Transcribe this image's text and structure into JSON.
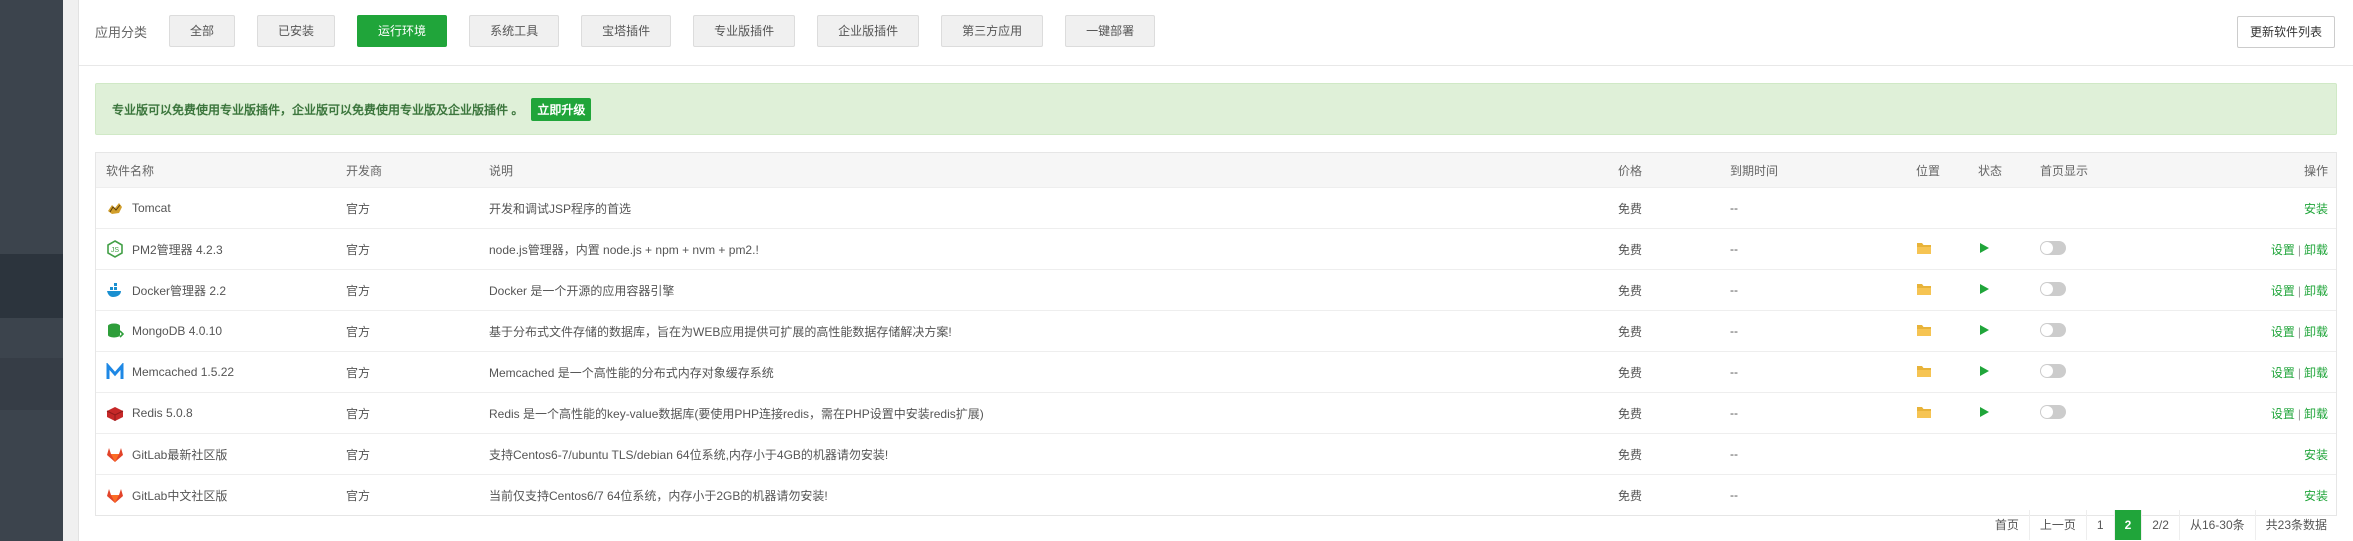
{
  "category": {
    "label": "应用分类",
    "buttons": [
      "全部",
      "已安装",
      "运行环境",
      "系统工具",
      "宝塔插件",
      "专业版插件",
      "企业版插件",
      "第三方应用",
      "一键部署"
    ],
    "active_index": 2
  },
  "update_button": "更新软件列表",
  "notice": {
    "text": "专业版可以免费使用专业版插件，企业版可以免费使用专业版及企业版插件 。",
    "button": "立即升级"
  },
  "table": {
    "headers": {
      "name": "软件名称",
      "dev": "开发商",
      "desc": "说明",
      "price": "价格",
      "expire": "到期时间",
      "location": "位置",
      "state": "状态",
      "home": "首页显示",
      "op": "操作"
    },
    "rows": [
      {
        "name": "Tomcat",
        "dev": "官方",
        "desc": "开发和调试JSP程序的首选",
        "price": "免费",
        "expire": "--",
        "installed": false,
        "icon": "tomcat-icon"
      },
      {
        "name": "PM2管理器 4.2.3",
        "dev": "官方",
        "desc": "node.js管理器，内置 node.js + npm + nvm + pm2.!",
        "price": "免费",
        "expire": "--",
        "installed": true,
        "icon": "nodejs-icon"
      },
      {
        "name": "Docker管理器 2.2",
        "dev": "官方",
        "desc": "Docker 是一个开源的应用容器引擎",
        "price": "免费",
        "expire": "--",
        "installed": true,
        "icon": "docker-icon"
      },
      {
        "name": "MongoDB 4.0.10",
        "dev": "官方",
        "desc": "基于分布式文件存储的数据库，旨在为WEB应用提供可扩展的高性能数据存储解决方案!",
        "price": "免费",
        "expire": "--",
        "installed": true,
        "icon": "mongodb-icon"
      },
      {
        "name": "Memcached 1.5.22",
        "dev": "官方",
        "desc": "Memcached 是一个高性能的分布式内存对象缓存系统",
        "price": "免费",
        "expire": "--",
        "installed": true,
        "icon": "memcached-icon"
      },
      {
        "name": "Redis 5.0.8",
        "dev": "官方",
        "desc": "Redis 是一个高性能的key-value数据库(要使用PHP连接redis，需在PHP设置中安装redis扩展)",
        "price": "免费",
        "expire": "--",
        "installed": true,
        "icon": "redis-icon"
      },
      {
        "name": "GitLab最新社区版",
        "dev": "官方",
        "desc": "支持Centos6-7/ubuntu TLS/debian 64位系统,内存小于4GB的机器请勿安装!",
        "price": "免费",
        "expire": "--",
        "installed": false,
        "icon": "gitlab-icon"
      },
      {
        "name": "GitLab中文社区版",
        "dev": "官方",
        "desc": "当前仅支持Centos6/7 64位系统，内存小于2GB的机器请勿安装!",
        "price": "免费",
        "expire": "--",
        "installed": false,
        "icon": "gitlab-icon"
      }
    ],
    "labels": {
      "install": "安装",
      "settings": "设置",
      "sep": "|",
      "uninstall": "卸载"
    }
  },
  "pager": {
    "first": "首页",
    "prev": "上一页",
    "p1": "1",
    "p2": "2",
    "total_pages": "2/2",
    "range": "从16-30条",
    "total": "共23条数据"
  }
}
